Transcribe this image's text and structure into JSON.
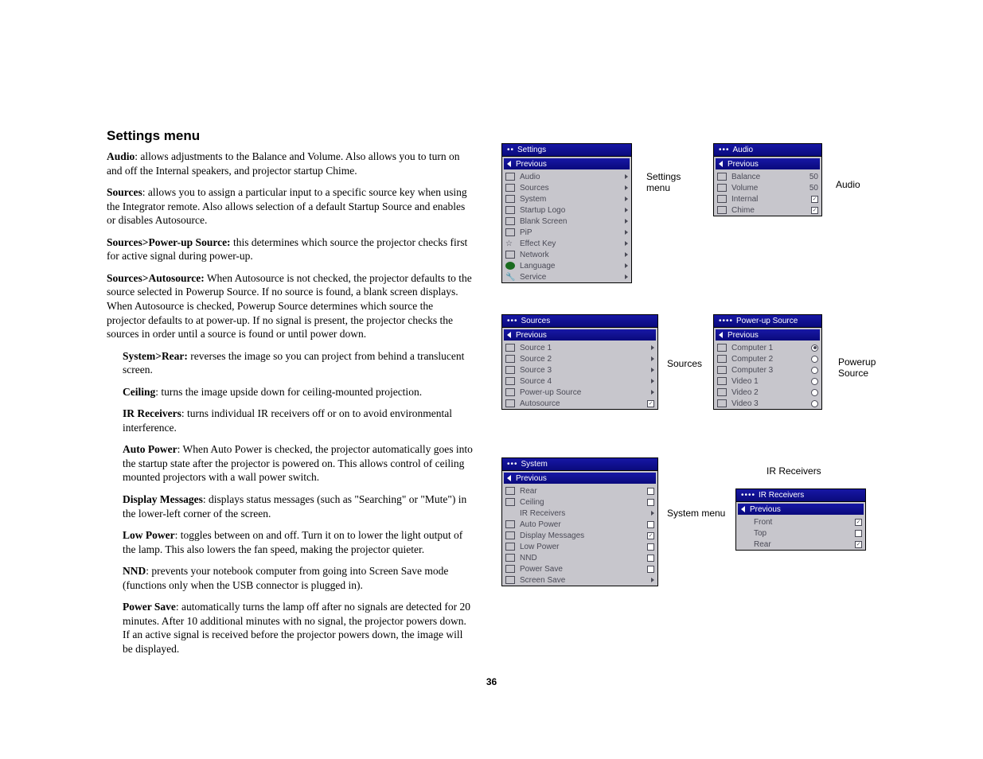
{
  "page_number": "36",
  "heading": "Settings menu",
  "paragraphs": {
    "audio_b": "Audio",
    "audio_t": ": allows adjustments to the Balance and Volume. Also allows you to turn on and off the Internal speakers, and projector startup Chime.",
    "sources_b": "Sources",
    "sources_t": ": allows you to assign a particular input to a specific source key when using the Integrator remote. Also allows selection of a default Startup Source and enables or disables Autosource.",
    "pus_b": "Sources>Power-up Source:",
    "pus_t": " this determines which source the projector checks first for active signal during power-up.",
    "auto_b": "Sources>Autosource:",
    "auto_t": " When Autosource is not checked, the projector defaults to the source selected in Powerup Source. If no source is found, a blank screen displays. When Autosource is checked, Powerup Source determines which source the projector defaults to at power-up. If no signal is present, the projector checks the sources in order until a source is found or until power down.",
    "rear_b": "System>Rear:",
    "rear_t": " reverses the image so you can project from behind a translucent screen.",
    "ceil_b": "Ceiling",
    "ceil_t": ": turns the image upside down for ceiling-mounted projection.",
    "ir_b": "IR Receivers",
    "ir_t": ": turns individual IR receivers off or on to avoid environmental interference.",
    "ap_b": "Auto Power",
    "ap_t": ": When Auto Power is checked, the projector automatically goes into the startup state after the projector is powered on. This allows control of ceiling mounted projectors with a wall power switch.",
    "dm_b": "Display Messages",
    "dm_t": ": displays status messages (such as \"Searching\" or \"Mute\") in the lower-left corner of the screen.",
    "lp_b": "Low Power",
    "lp_t": ": toggles between on and off. Turn it on to lower the light output of the lamp. This also lowers the fan speed, making the projector quieter.",
    "nnd_b": "NND",
    "nnd_t": ": prevents your notebook computer from going into Screen Save mode (functions only when the USB connector is plugged in).",
    "ps_b": "Power Save",
    "ps_t": ": automatically turns the lamp off after no signals are detected for 20 minutes. After 10 additional minutes with no signal, the projector powers down. If an active signal is received before the projector powers down, the image will be displayed."
  },
  "captions": {
    "settings": "Settings menu",
    "audio": "Audio",
    "sources": "Sources",
    "powerup": "Powerup Source",
    "system": "System menu",
    "ir": "IR Receivers"
  },
  "menus": {
    "previous": "Previous",
    "settings": {
      "title": "Settings",
      "items": [
        "Audio",
        "Sources",
        "System",
        "Startup Logo",
        "Blank Screen",
        "PiP",
        "Effect Key",
        "Network",
        "Language",
        "Service"
      ]
    },
    "audio": {
      "title": "Audio",
      "balance": {
        "label": "Balance",
        "value": "50"
      },
      "volume": {
        "label": "Volume",
        "value": "50"
      },
      "internal": {
        "label": "Internal",
        "checked": true
      },
      "chime": {
        "label": "Chime",
        "checked": true
      }
    },
    "sources": {
      "title": "Sources",
      "items": [
        "Source 1",
        "Source 2",
        "Source 3",
        "Source 4",
        "Power-up Source"
      ],
      "autosource": {
        "label": "Autosource",
        "checked": true
      }
    },
    "powerup": {
      "title": "Power-up Source",
      "items": [
        {
          "label": "Computer 1",
          "selected": true
        },
        {
          "label": "Computer 2",
          "selected": false
        },
        {
          "label": "Computer 3",
          "selected": false
        },
        {
          "label": "Video 1",
          "selected": false
        },
        {
          "label": "Video 2",
          "selected": false
        },
        {
          "label": "Video 3",
          "selected": false
        }
      ]
    },
    "system": {
      "title": "System",
      "items": [
        {
          "label": "Rear",
          "type": "check",
          "checked": false
        },
        {
          "label": "Ceiling",
          "type": "check",
          "checked": false
        },
        {
          "label": "IR Receivers",
          "type": "arrow"
        },
        {
          "label": "Auto Power",
          "type": "check",
          "checked": false
        },
        {
          "label": "Display Messages",
          "type": "check",
          "checked": true
        },
        {
          "label": "Low Power",
          "type": "check",
          "checked": false
        },
        {
          "label": "NND",
          "type": "check",
          "checked": false
        },
        {
          "label": "Power Save",
          "type": "check",
          "checked": false
        },
        {
          "label": "Screen Save",
          "type": "arrow"
        }
      ]
    },
    "ir": {
      "title": "IR Receivers",
      "items": [
        {
          "label": "Front",
          "checked": true
        },
        {
          "label": "Top",
          "checked": false
        },
        {
          "label": "Rear",
          "checked": true
        }
      ]
    }
  }
}
